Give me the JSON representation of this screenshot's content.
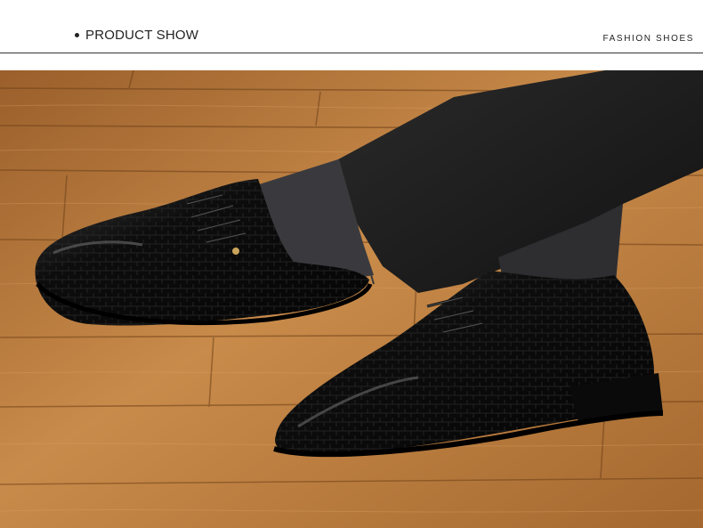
{
  "header": {
    "title": "PRODUCT SHOW",
    "right_label": "FASHION SHOES"
  },
  "photo": {
    "description_icon": "product-photo",
    "colors": {
      "floor": "#b87a3e",
      "floor_dark": "#8a5426",
      "shoe": "#0c0c0c",
      "trousers": "#1d1d1d",
      "sock": "#3a3a3e"
    }
  }
}
